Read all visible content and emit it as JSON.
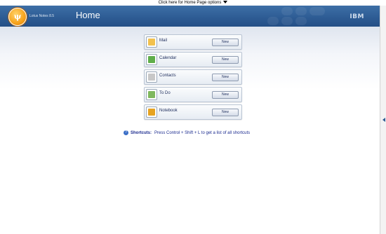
{
  "topbar": {
    "options_link": "Click here for Home Page options"
  },
  "header": {
    "product": "Lotus Notes 8.5",
    "title": "Home",
    "brand": "IBM"
  },
  "apps": [
    {
      "label": "Mail",
      "new_label": "New",
      "icon": "mail-icon",
      "color": "#f2c14e"
    },
    {
      "label": "Calendar",
      "new_label": "New",
      "icon": "calendar-icon",
      "color": "#5fae4a"
    },
    {
      "label": "Contacts",
      "new_label": "New",
      "icon": "contacts-icon",
      "color": "#c8c8c8"
    },
    {
      "label": "To Do",
      "new_label": "New",
      "icon": "todo-icon",
      "color": "#7fb85d"
    },
    {
      "label": "Notebook",
      "new_label": "New",
      "icon": "notebook-icon",
      "color": "#e6a321"
    }
  ],
  "shortcuts": {
    "heading": "Shortcuts:",
    "text": "Press Control + Shift + L to get a list of all shortcuts"
  }
}
